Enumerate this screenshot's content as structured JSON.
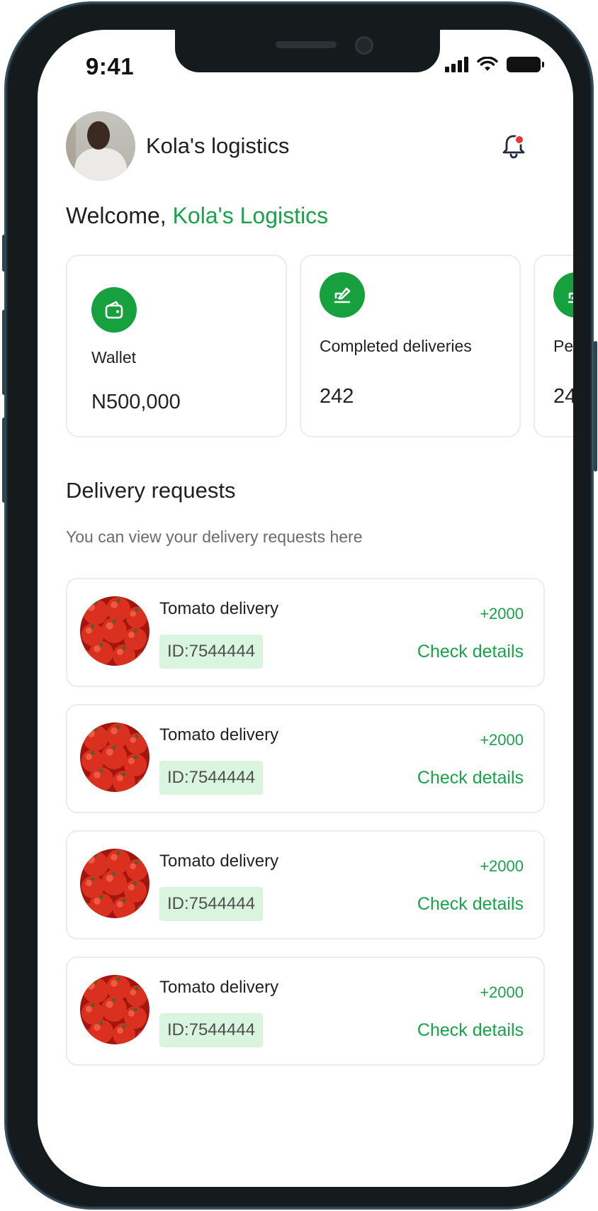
{
  "status_bar": {
    "time": "9:41",
    "icons": [
      "signal-icon",
      "wifi-icon",
      "battery-icon"
    ]
  },
  "header": {
    "company_name": "Kola's logistics",
    "avatar": "profile-photo",
    "notification_icon": "bell-icon"
  },
  "welcome": {
    "prefix": "Welcome, ",
    "name": "Kola's Logistics"
  },
  "stats": [
    {
      "icon": "wallet-icon",
      "label": "Wallet",
      "value": "N500,000"
    },
    {
      "icon": "edit-icon",
      "label": "Completed deliveries",
      "value": "242"
    },
    {
      "icon": "edit-icon",
      "label": "Pe",
      "value": "24"
    }
  ],
  "requests_section": {
    "title": "Delivery requests",
    "subtitle": "You can view your delivery requests here"
  },
  "requests": [
    {
      "title": "Tomato delivery",
      "id": "ID:7544444",
      "amount": "+2000",
      "action": "Check details"
    },
    {
      "title": "Tomato delivery",
      "id": "ID:7544444",
      "amount": "+2000",
      "action": "Check details"
    },
    {
      "title": "Tomato delivery",
      "id": "ID:7544444",
      "amount": "+2000",
      "action": "Check details"
    },
    {
      "title": "Tomato delivery",
      "id": "ID:7544444",
      "amount": "+2000",
      "action": "Check details"
    }
  ],
  "colors": {
    "accent": "#18a24a",
    "icon_bg": "#17a03e",
    "id_badge_bg": "#d9f5df",
    "alert": "#e53935"
  }
}
